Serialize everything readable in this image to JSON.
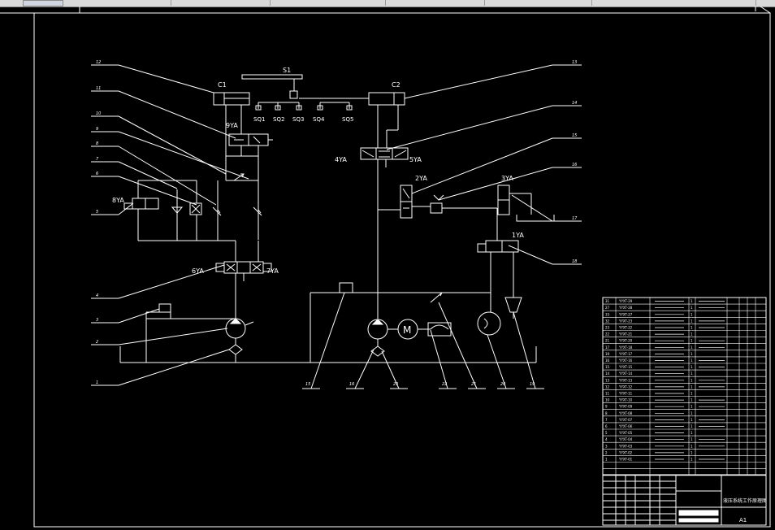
{
  "colors": {
    "background": "#000000",
    "line": "#ffffff",
    "toolbar": "#d9d9d9"
  },
  "components": {
    "c1": "C1",
    "c2": "C2",
    "s1": "S1",
    "sq1": "SQ1",
    "sq2": "SQ2",
    "sq3": "SQ3",
    "sq4": "SQ4",
    "sq5": "SQ5",
    "yv1": "1YA",
    "yv2": "2YA",
    "yv3": "3YA",
    "yv4": "4YA",
    "yv5": "5YA",
    "yv6": "6YA",
    "yv7": "7YA",
    "yv8": "8YA",
    "yv9": "9YA",
    "motor": "M"
  },
  "callouts": {
    "left": [
      "12",
      "11",
      "10",
      "9",
      "8",
      "7",
      "6",
      "5",
      "4",
      "3",
      "2",
      "1"
    ],
    "right": [
      "13",
      "14",
      "15",
      "16",
      "17",
      "18"
    ],
    "bottom": [
      "15",
      "16",
      "23",
      "22",
      "21",
      "20",
      "19"
    ]
  },
  "parts_table": {
    "rows": [
      {
        "no": "31",
        "code": "YYXT-29",
        "qty": "1"
      },
      {
        "no": "27",
        "code": "YYXT-28",
        "qty": "1"
      },
      {
        "no": "33",
        "code": "YYXT-27",
        "qty": "1"
      },
      {
        "no": "32",
        "code": "YYXT-23",
        "qty": "1"
      },
      {
        "no": "23",
        "code": "YYXT-22",
        "qty": "1"
      },
      {
        "no": "22",
        "code": "YYXT-21",
        "qty": "1"
      },
      {
        "no": "21",
        "code": "YYXT-20",
        "qty": "1"
      },
      {
        "no": "17",
        "code": "YYXT-18",
        "qty": "1"
      },
      {
        "no": "19",
        "code": "YYXT-17",
        "qty": "1"
      },
      {
        "no": "16",
        "code": "YYXT-16",
        "qty": "1"
      },
      {
        "no": "15",
        "code": "YYXT-15",
        "qty": "1"
      },
      {
        "no": "14",
        "code": "YYXT-14",
        "qty": "1"
      },
      {
        "no": "13",
        "code": "YYXT-13",
        "qty": "1"
      },
      {
        "no": "12",
        "code": "YYXT-12",
        "qty": "1"
      },
      {
        "no": "11",
        "code": "YYXT-11",
        "qty": "1"
      },
      {
        "no": "10",
        "code": "YYXT-10",
        "qty": "1"
      },
      {
        "no": "9",
        "code": "YYXT-09",
        "qty": "1"
      },
      {
        "no": "8",
        "code": "YYXT-08",
        "qty": "1"
      },
      {
        "no": "7",
        "code": "YYXT-07",
        "qty": "1"
      },
      {
        "no": "6",
        "code": "YYXT-06",
        "qty": "1"
      },
      {
        "no": "5",
        "code": "YYXT-05",
        "qty": "1"
      },
      {
        "no": "4",
        "code": "YYXT-04",
        "qty": "1"
      },
      {
        "no": "3",
        "code": "YYXT-03",
        "qty": "1"
      },
      {
        "no": "2",
        "code": "YYXT-02",
        "qty": "1"
      },
      {
        "no": "1",
        "code": "YYXT-01",
        "qty": "1"
      }
    ]
  },
  "title_block": {
    "title": "液压系统工作原理图",
    "sheet": "A1"
  }
}
